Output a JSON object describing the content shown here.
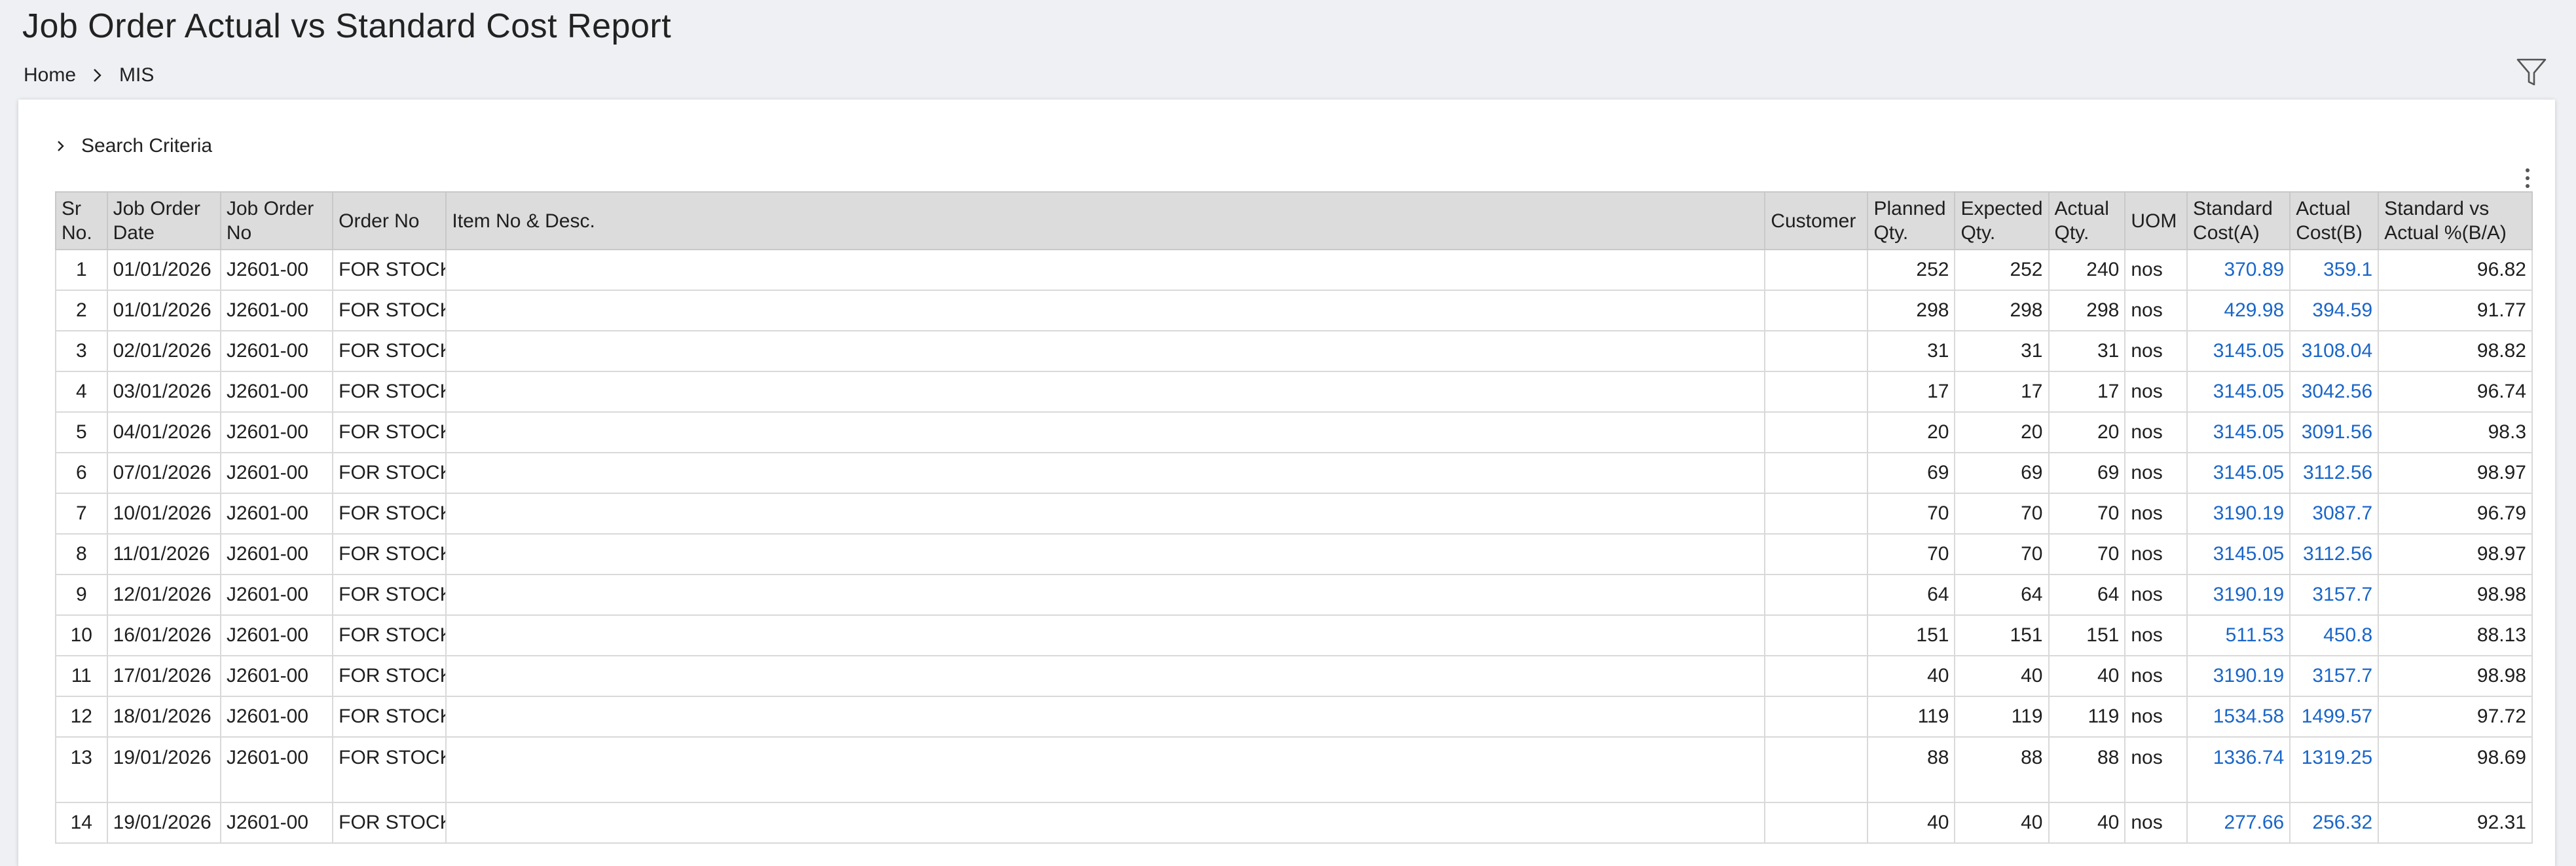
{
  "page": {
    "title": "Job Order Actual vs Standard Cost Report",
    "breadcrumb": [
      "Home",
      "MIS"
    ]
  },
  "search": {
    "label": "Search Criteria"
  },
  "table": {
    "headers": {
      "sr": [
        "Sr",
        "No."
      ],
      "jo_date": [
        "Job Order",
        "Date"
      ],
      "jo_no": [
        "Job Order",
        "No"
      ],
      "order_no": "Order No",
      "item": "Item No & Desc.",
      "customer": "Customer",
      "planned": [
        "Planned",
        "Qty."
      ],
      "expected": [
        "Expected",
        "Qty."
      ],
      "actual": [
        "Actual",
        "Qty."
      ],
      "uom": "UOM",
      "std_cost": [
        "Standard",
        "Cost(A)"
      ],
      "act_cost": [
        "Actual",
        "Cost(B)"
      ],
      "pct": [
        "Standard vs",
        "Actual %(B/A)"
      ]
    },
    "rows": [
      {
        "sr": "1",
        "date": "01/01/2026",
        "jo": "J2601-00",
        "order": "FOR STOCK",
        "item": "",
        "customer": "",
        "planned": "252",
        "expected": "252",
        "actual": "240",
        "uom": "nos",
        "std": "370.89",
        "act": "359.1",
        "pct": "96.82"
      },
      {
        "sr": "2",
        "date": "01/01/2026",
        "jo": "J2601-00",
        "order": "FOR STOCK",
        "item": "",
        "customer": "",
        "planned": "298",
        "expected": "298",
        "actual": "298",
        "uom": "nos",
        "std": "429.98",
        "act": "394.59",
        "pct": "91.77"
      },
      {
        "sr": "3",
        "date": "02/01/2026",
        "jo": "J2601-00",
        "order": "FOR STOCK",
        "item": "",
        "customer": "",
        "planned": "31",
        "expected": "31",
        "actual": "31",
        "uom": "nos",
        "std": "3145.05",
        "act": "3108.04",
        "pct": "98.82"
      },
      {
        "sr": "4",
        "date": "03/01/2026",
        "jo": "J2601-00",
        "order": "FOR STOCK",
        "item": "",
        "customer": "",
        "planned": "17",
        "expected": "17",
        "actual": "17",
        "uom": "nos",
        "std": "3145.05",
        "act": "3042.56",
        "pct": "96.74"
      },
      {
        "sr": "5",
        "date": "04/01/2026",
        "jo": "J2601-00",
        "order": "FOR STOCK",
        "item": "",
        "customer": "",
        "planned": "20",
        "expected": "20",
        "actual": "20",
        "uom": "nos",
        "std": "3145.05",
        "act": "3091.56",
        "pct": "98.3"
      },
      {
        "sr": "6",
        "date": "07/01/2026",
        "jo": "J2601-00",
        "order": "FOR STOCK",
        "item": "",
        "customer": "",
        "planned": "69",
        "expected": "69",
        "actual": "69",
        "uom": "nos",
        "std": "3145.05",
        "act": "3112.56",
        "pct": "98.97"
      },
      {
        "sr": "7",
        "date": "10/01/2026",
        "jo": "J2601-00",
        "order": "FOR STOCK",
        "item": "",
        "customer": "",
        "planned": "70",
        "expected": "70",
        "actual": "70",
        "uom": "nos",
        "std": "3190.19",
        "act": "3087.7",
        "pct": "96.79"
      },
      {
        "sr": "8",
        "date": "11/01/2026",
        "jo": "J2601-00",
        "order": "FOR STOCK",
        "item": "",
        "customer": "",
        "planned": "70",
        "expected": "70",
        "actual": "70",
        "uom": "nos",
        "std": "3145.05",
        "act": "3112.56",
        "pct": "98.97"
      },
      {
        "sr": "9",
        "date": "12/01/2026",
        "jo": "J2601-00",
        "order": "FOR STOCK",
        "item": "",
        "customer": "",
        "planned": "64",
        "expected": "64",
        "actual": "64",
        "uom": "nos",
        "std": "3190.19",
        "act": "3157.7",
        "pct": "98.98"
      },
      {
        "sr": "10",
        "date": "16/01/2026",
        "jo": "J2601-00",
        "order": "FOR STOCK",
        "item": "",
        "customer": "",
        "planned": "151",
        "expected": "151",
        "actual": "151",
        "uom": "nos",
        "std": "511.53",
        "act": "450.8",
        "pct": "88.13"
      },
      {
        "sr": "11",
        "date": "17/01/2026",
        "jo": "J2601-00",
        "order": "FOR STOCK",
        "item": "",
        "customer": "",
        "planned": "40",
        "expected": "40",
        "actual": "40",
        "uom": "nos",
        "std": "3190.19",
        "act": "3157.7",
        "pct": "98.98"
      },
      {
        "sr": "12",
        "date": "18/01/2026",
        "jo": "J2601-00",
        "order": "FOR STOCK",
        "item": "",
        "customer": "",
        "planned": "119",
        "expected": "119",
        "actual": "119",
        "uom": "nos",
        "std": "1534.58",
        "act": "1499.57",
        "pct": "97.72"
      },
      {
        "sr": "13",
        "date": "19/01/2026",
        "jo": "J2601-00",
        "order": "FOR STOCK",
        "item": "",
        "customer": "",
        "planned": "88",
        "expected": "88",
        "actual": "88",
        "uom": "nos",
        "std": "1336.74",
        "act": "1319.25",
        "pct": "98.69",
        "tall": true
      },
      {
        "sr": "14",
        "date": "19/01/2026",
        "jo": "J2601-00",
        "order": "FOR STOCK",
        "item": "",
        "customer": "",
        "planned": "40",
        "expected": "40",
        "actual": "40",
        "uom": "nos",
        "std": "277.66",
        "act": "256.32",
        "pct": "92.31"
      }
    ]
  },
  "colors": {
    "link": "#1a66c9",
    "header_bg": "#dcdcdc",
    "page_bg": "#eef0f3"
  },
  "icons": {
    "filter": "filter-icon",
    "breadcrumb_sep": "chevron-right-icon",
    "search_toggle": "chevron-right-icon",
    "menu": "kebab-menu-icon"
  }
}
